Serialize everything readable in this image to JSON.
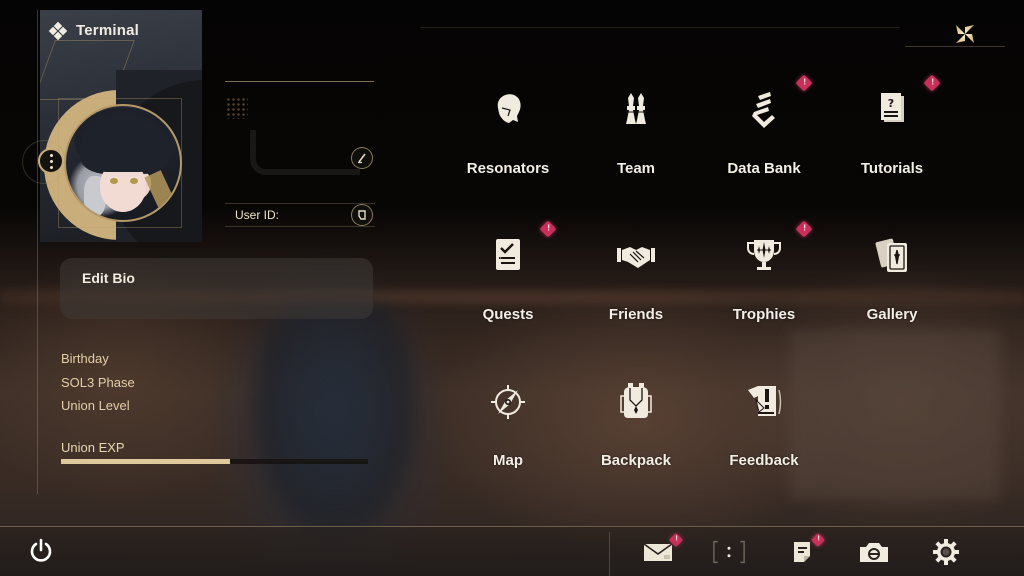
{
  "header": {
    "title": "Terminal",
    "title_icon": "diamond-cluster-icon",
    "close_icon": "close-x-icon"
  },
  "profile": {
    "user_id_label": "User ID:",
    "user_id_value": "",
    "edit_name_icon": "pencil-icon",
    "copy_id_icon": "copy-icon",
    "more_icon": "more-vertical-icon",
    "bio_placeholder": "Edit Bio",
    "info": [
      {
        "label": "Birthday",
        "value": ""
      },
      {
        "label": "SOL3 Phase",
        "value": ""
      },
      {
        "label": "Union Level",
        "value": ""
      }
    ],
    "exp_label": "Union EXP",
    "exp_progress": 0.55
  },
  "menu": {
    "items": [
      {
        "id": "resonators",
        "label": "Resonators",
        "icon": "resonator-head-icon",
        "badge": false
      },
      {
        "id": "team",
        "label": "Team",
        "icon": "chess-pieces-icon",
        "badge": false
      },
      {
        "id": "data-bank",
        "label": "Data Bank",
        "icon": "data-bank-icon",
        "badge": true
      },
      {
        "id": "tutorials",
        "label": "Tutorials",
        "icon": "question-document-icon",
        "badge": true
      },
      {
        "id": "quests",
        "label": "Quests",
        "icon": "checklist-icon",
        "badge": true
      },
      {
        "id": "friends",
        "label": "Friends",
        "icon": "handshake-icon",
        "badge": false
      },
      {
        "id": "trophies",
        "label": "Trophies",
        "icon": "trophy-icon",
        "badge": true
      },
      {
        "id": "gallery",
        "label": "Gallery",
        "icon": "cards-icon",
        "badge": false
      },
      {
        "id": "map",
        "label": "Map",
        "icon": "compass-icon",
        "badge": false
      },
      {
        "id": "backpack",
        "label": "Backpack",
        "icon": "backpack-icon",
        "badge": false
      },
      {
        "id": "feedback",
        "label": "Feedback",
        "icon": "feedback-icon",
        "badge": false
      }
    ]
  },
  "bottom_bar": {
    "power_icon": "power-icon",
    "buttons": [
      {
        "id": "mail",
        "icon": "mail-icon",
        "badge": true
      },
      {
        "id": "chat",
        "icon": "chat-bracket-icon",
        "badge": false
      },
      {
        "id": "announcements",
        "icon": "notice-icon",
        "badge": true
      },
      {
        "id": "photo",
        "icon": "camera-icon",
        "badge": false
      },
      {
        "id": "settings",
        "icon": "gear-icon",
        "badge": false
      }
    ]
  },
  "colors": {
    "accent_gold": "#c9ad7a",
    "badge_red": "#c8305a",
    "text_primary": "#f3efe6",
    "text_gold": "#e2cfa8"
  }
}
